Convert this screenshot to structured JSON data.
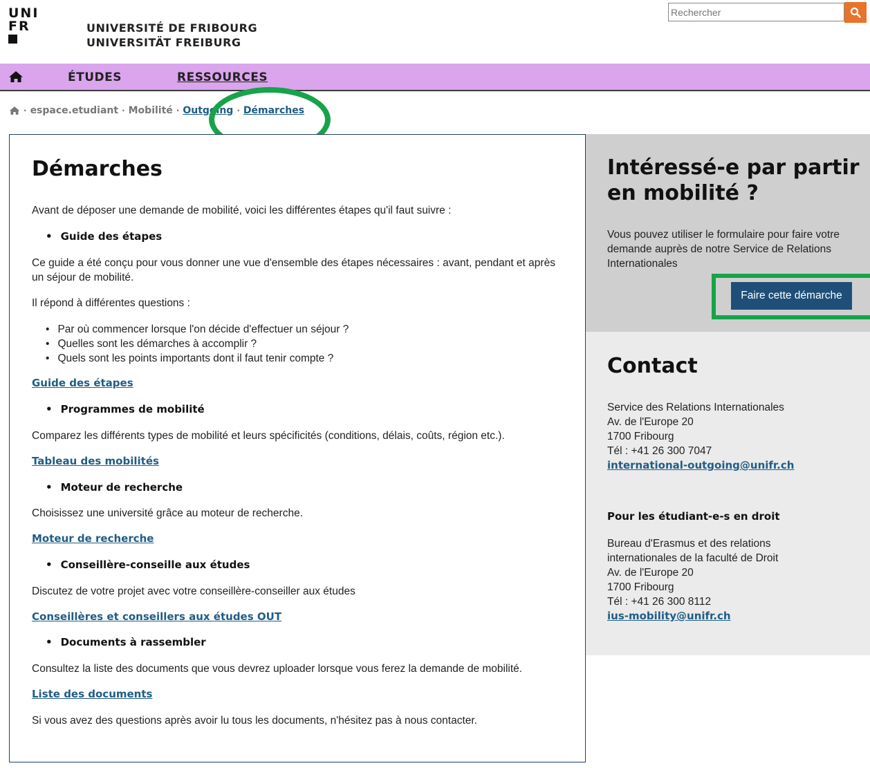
{
  "header": {
    "logo_lines": [
      "UNI",
      "FR"
    ],
    "name_fr": "UNIVERSITÉ DE FRIBOURG",
    "name_de": "UNIVERSITÄT FREIBURG",
    "search_placeholder": "Rechercher"
  },
  "nav": {
    "items": [
      "ÉTUDES",
      "RESSOURCES"
    ]
  },
  "breadcrumb": [
    "espace.etudiant",
    "Mobilité",
    "Outgoing",
    "Démarches"
  ],
  "main": {
    "title": "Démarches",
    "intro": "Avant de déposer une demande de mobilité, voici les différentes étapes qu'il faut suivre :",
    "s1_title": "Guide des étapes",
    "s1_text": "Ce guide a été conçu pour vous donner une vue d'ensemble des étapes nécessaires : avant, pendant et après un séjour de mobilité.",
    "s1_text2": "Il répond à différentes questions :",
    "s1_q": [
      "Par où commencer lorsque l'on décide d'effectuer un séjour ?",
      "Quelles sont les démarches à accomplir ?",
      "Quels sont les points importants dont il faut tenir compte ?"
    ],
    "s1_link": "Guide des étapes",
    "s2_title": "Programmes de mobilité",
    "s2_text": "Comparez les différents types de mobilité et leurs spécificités (conditions, délais, coûts, région etc.).",
    "s2_link": "Tableau des mobilités",
    "s3_title": "Moteur de recherche",
    "s3_text": "Choisissez une université grâce au moteur de recherche.",
    "s3_link": "Moteur de recherche",
    "s4_title": "Conseillère-conseille aux études",
    "s4_text": "Discutez de votre projet avec votre conseillère-conseiller aux études",
    "s4_link": "Conseillères et conseillers aux études OUT",
    "s5_title": "Documents à rassembler",
    "s5_text": "Consultez la liste des documents que vous devrez uploader lorsque vous ferez la demande de mobilité.",
    "s5_link": "Liste des documents",
    "outro": "Si vous avez des questions après avoir lu tous les documents, n'hésitez pas à nous contacter."
  },
  "sidebar": {
    "cta_title": "Intéressé-e par partir en mobilité ?",
    "cta_text": "Vous pouvez utiliser le formulaire pour faire votre demande auprès de notre Service de Relations Internationales",
    "cta_button": "Faire cette démarche",
    "contact_title": "Contact",
    "c1": [
      "Service des Relations Internationales",
      "Av. de l'Europe 20",
      "1700 Fribourg",
      "Tél : +41 26 300 7047"
    ],
    "c1_email": "international-outgoing@unifr.ch",
    "law_title": "Pour les étudiant-e-s en droit",
    "c2": [
      "Bureau d'Erasmus et des relations",
      "internationales de la faculté de Droit",
      "Av. de l'Europe 20",
      "1700 Fribourg",
      "Tél : +41 26 300 8112"
    ],
    "c2_email": "ius-mobility@unifr.ch"
  },
  "colors": {
    "nav_bg": "#daa5ec",
    "link": "#1f5d86",
    "button": "#1f4f78",
    "search_button": "#e8732a",
    "annotation": "#17a34a"
  }
}
